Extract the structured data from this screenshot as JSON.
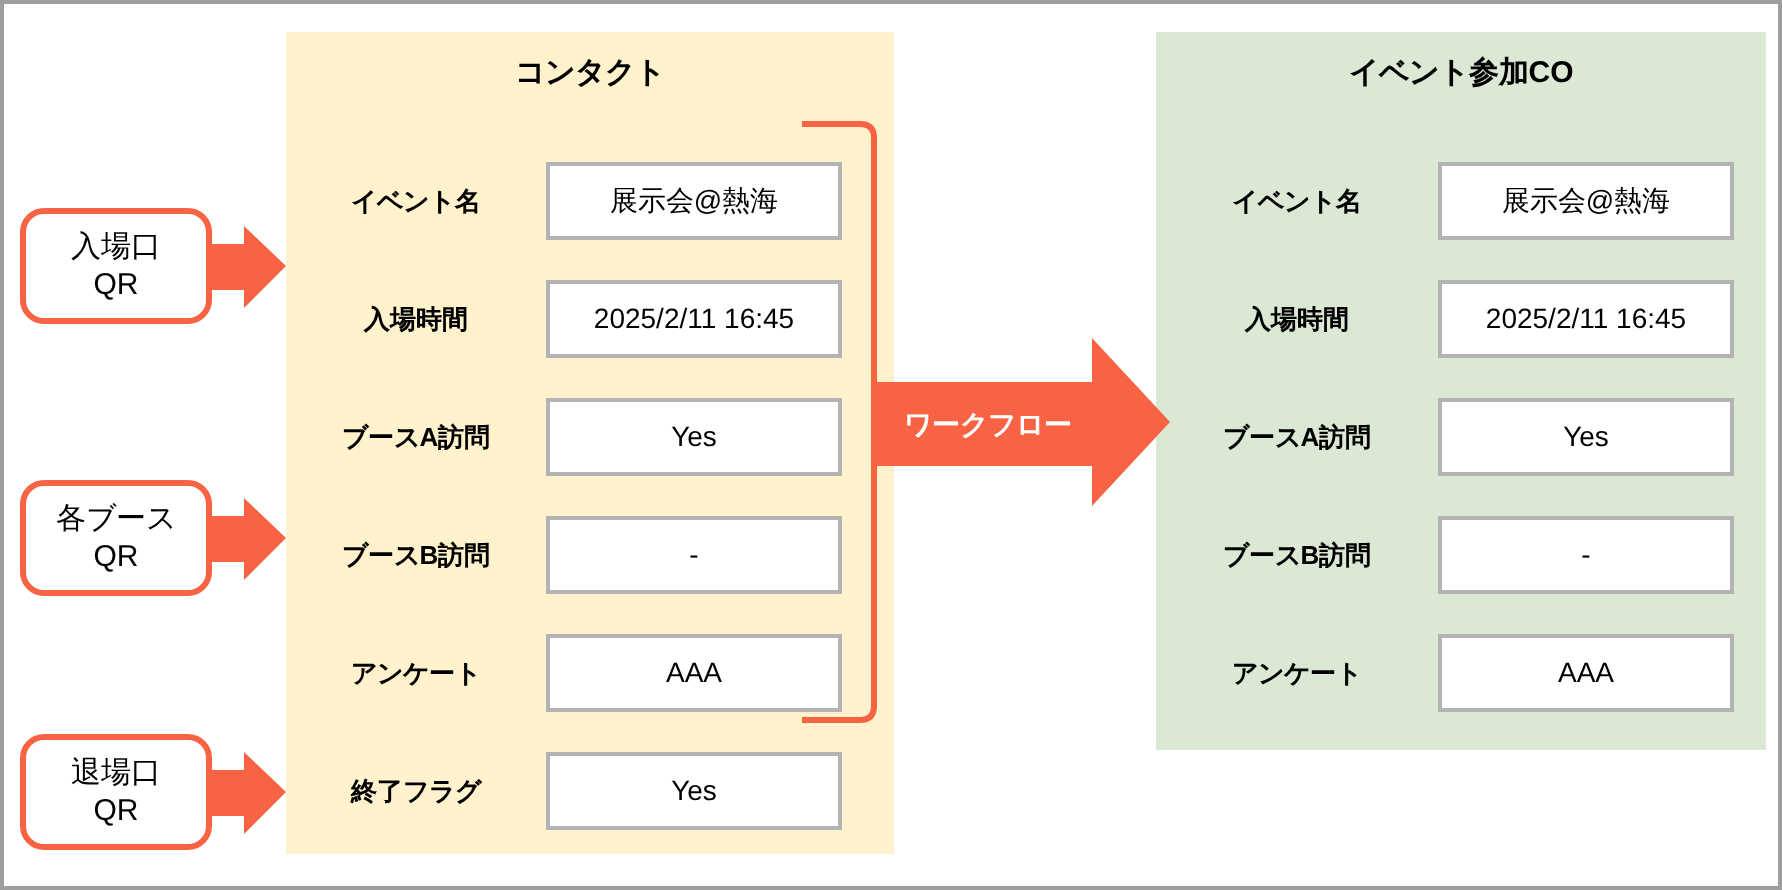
{
  "sources": [
    {
      "label": "入場口\nQR"
    },
    {
      "label": "各ブース\nQR"
    },
    {
      "label": "退場口\nQR"
    }
  ],
  "contact": {
    "title": "コンタクト",
    "fields": [
      {
        "label": "イベント名",
        "value": "展示会@熱海"
      },
      {
        "label": "入場時間",
        "value": "2025/2/11 16:45"
      },
      {
        "label": "ブースA訪問",
        "value": "Yes"
      },
      {
        "label": "ブースB訪問",
        "value": "-"
      },
      {
        "label": "アンケート",
        "value": "AAA"
      },
      {
        "label": "終了フラグ",
        "value": "Yes"
      }
    ]
  },
  "workflow": {
    "label": "ワークフロー"
  },
  "event_co": {
    "title": "イベント参加CO",
    "fields": [
      {
        "label": "イベント名",
        "value": "展示会@熱海"
      },
      {
        "label": "入場時間",
        "value": "2025/2/11 16:45"
      },
      {
        "label": "ブースA訪問",
        "value": "Yes"
      },
      {
        "label": "ブースB訪問",
        "value": "-"
      },
      {
        "label": "アンケート",
        "value": "AAA"
      }
    ]
  }
}
